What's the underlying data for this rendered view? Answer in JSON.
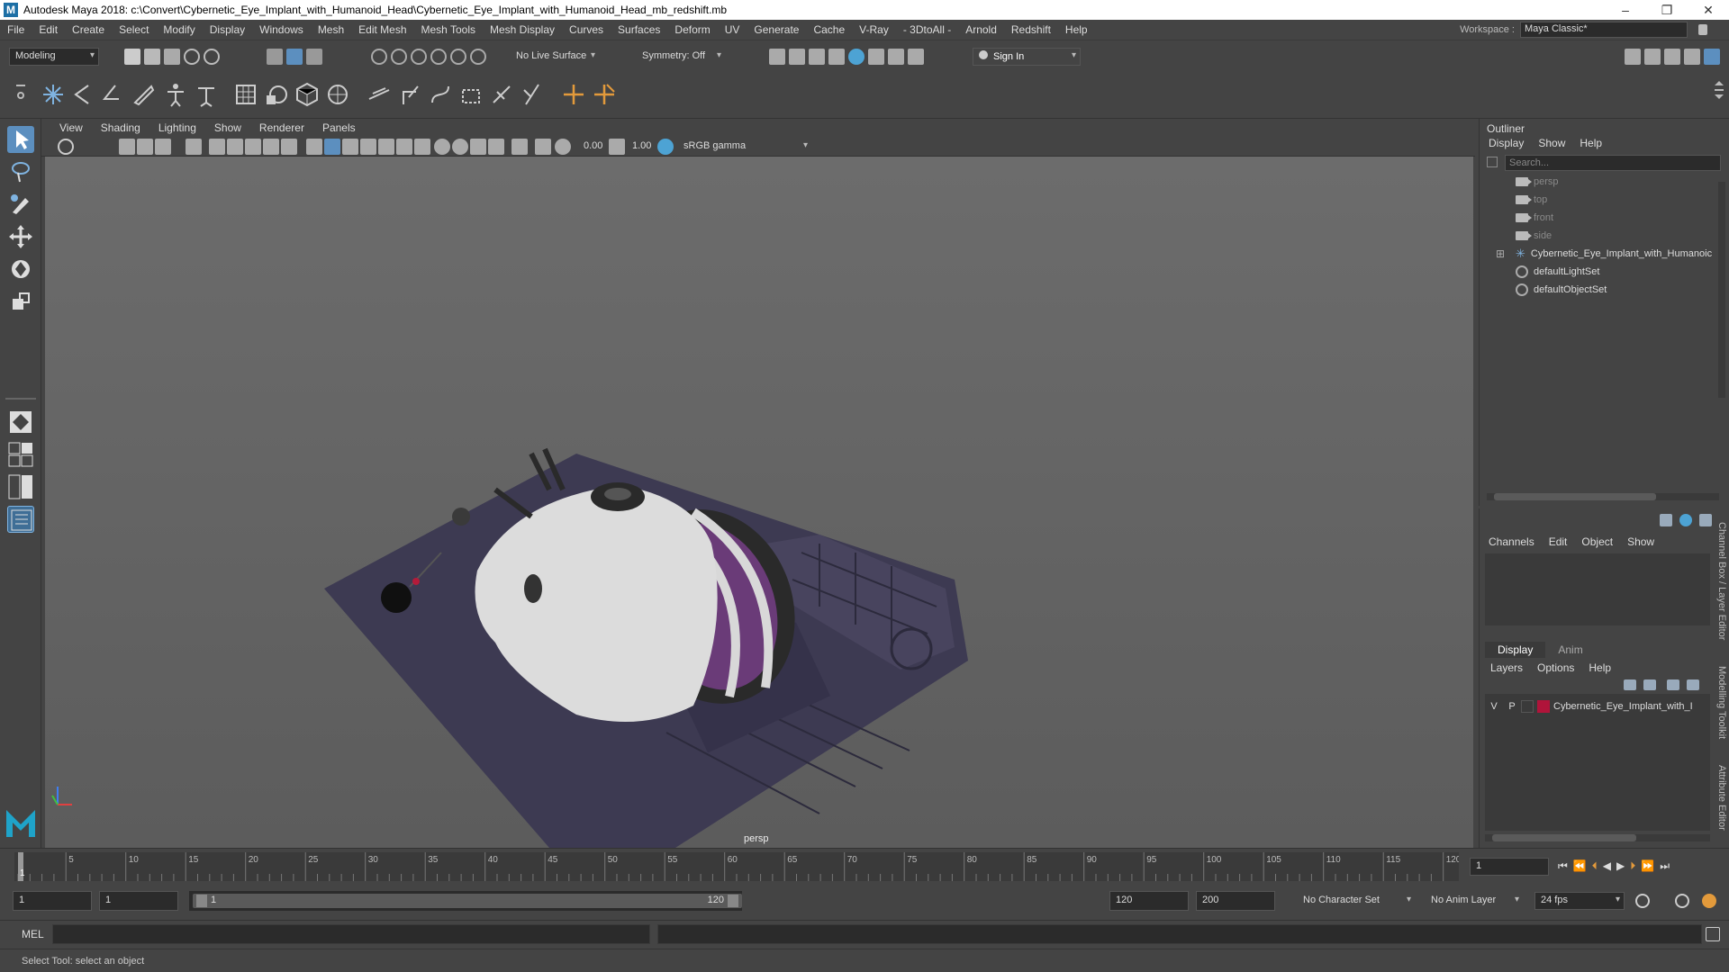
{
  "window": {
    "title": "Autodesk Maya 2018: c:\\Convert\\Cybernetic_Eye_Implant_with_Humanoid_Head\\Cybernetic_Eye_Implant_with_Humanoid_Head_mb_redshift.mb",
    "minimize": "–",
    "maximize": "❐",
    "close": "✕"
  },
  "menubar": {
    "items": [
      "File",
      "Edit",
      "Create",
      "Select",
      "Modify",
      "Display",
      "Windows",
      "Mesh",
      "Edit Mesh",
      "Mesh Tools",
      "Mesh Display",
      "Curves",
      "Surfaces",
      "Deform",
      "UV",
      "Generate",
      "Cache",
      "V-Ray",
      "- 3DtoAll -",
      "Arnold",
      "Redshift",
      "Help"
    ],
    "workspace_label": "Workspace :",
    "workspace_value": "Maya Classic*"
  },
  "statusline": {
    "mode": "Modeling",
    "live_surface": "No Live Surface",
    "symmetry": "Symmetry: Off",
    "sign_in": "Sign In"
  },
  "viewport": {
    "menu": [
      "View",
      "Shading",
      "Lighting",
      "Show",
      "Renderer",
      "Panels"
    ],
    "exposure": "0.00",
    "gamma": "1.00",
    "color_space": "sRGB gamma",
    "camera_label": "persp"
  },
  "outliner": {
    "title": "Outliner",
    "menu": [
      "Display",
      "Show",
      "Help"
    ],
    "search_placeholder": "Search...",
    "items": [
      {
        "label": "persp",
        "type": "camera"
      },
      {
        "label": "top",
        "type": "camera"
      },
      {
        "label": "front",
        "type": "camera"
      },
      {
        "label": "side",
        "type": "camera"
      },
      {
        "label": "Cybernetic_Eye_Implant_with_Humanoic",
        "type": "group"
      },
      {
        "label": "defaultLightSet",
        "type": "set"
      },
      {
        "label": "defaultObjectSet",
        "type": "set"
      }
    ]
  },
  "channelbox": {
    "menu": [
      "Channels",
      "Edit",
      "Object",
      "Show"
    ],
    "layer_tabs": [
      "Display",
      "Anim"
    ],
    "layer_menu": [
      "Layers",
      "Options",
      "Help"
    ],
    "layer": {
      "v": "V",
      "p": "P",
      "name": "Cybernetic_Eye_Implant_with_I",
      "color": "#b0143a"
    },
    "side_tabs": [
      "Channel Box / Layer Editor",
      "Modelling Toolkit",
      "Attribute Editor"
    ]
  },
  "timeline": {
    "ticks": [
      "5",
      "10",
      "15",
      "20",
      "25",
      "30",
      "35",
      "40",
      "45",
      "50",
      "55",
      "60",
      "65",
      "70",
      "75",
      "80",
      "85",
      "90",
      "95",
      "100",
      "105",
      "110",
      "115",
      "120"
    ],
    "current_frame_marker": "1",
    "current_frame": "1"
  },
  "range": {
    "start": "1",
    "playback_start": "1",
    "slider_start": "1",
    "slider_end": "120",
    "playback_end": "120",
    "end": "200",
    "character_set": "No Character Set",
    "anim_layer": "No Anim Layer",
    "fps": "24 fps"
  },
  "cmdline": {
    "label": "MEL"
  },
  "helpline": {
    "text": "Select Tool: select an object"
  }
}
